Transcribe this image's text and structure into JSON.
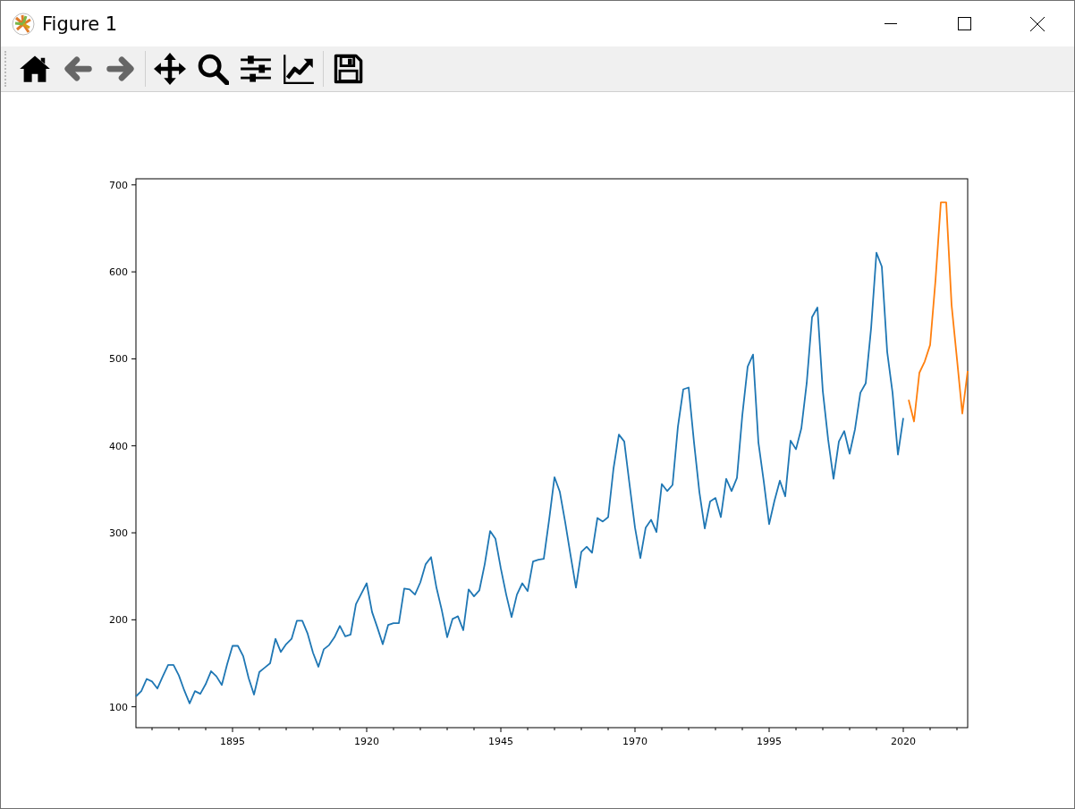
{
  "window": {
    "title": "Figure 1"
  },
  "toolbar": [
    [
      {
        "kind": "home",
        "disabled": false
      },
      {
        "kind": "back",
        "disabled": true
      },
      {
        "kind": "forward",
        "disabled": true
      }
    ],
    [
      {
        "kind": "pan",
        "disabled": false
      },
      {
        "kind": "zoom",
        "disabled": false
      },
      {
        "kind": "configure",
        "disabled": false
      },
      {
        "kind": "edit",
        "disabled": false
      }
    ],
    [
      {
        "kind": "save",
        "disabled": false
      }
    ]
  ],
  "figure": {
    "chart_data": {
      "type": "line",
      "x": [
        1877,
        1878,
        1879,
        1880,
        1881,
        1882,
        1883,
        1884,
        1885,
        1886,
        1887,
        1888,
        1889,
        1890,
        1891,
        1892,
        1893,
        1894,
        1895,
        1896,
        1897,
        1898,
        1899,
        1900,
        1901,
        1902,
        1903,
        1904,
        1905,
        1906,
        1907,
        1908,
        1909,
        1910,
        1911,
        1912,
        1913,
        1914,
        1915,
        1916,
        1917,
        1918,
        1919,
        1920,
        1921,
        1922,
        1923,
        1924,
        1925,
        1926,
        1927,
        1928,
        1929,
        1930,
        1931,
        1932,
        1933,
        1934,
        1935,
        1936,
        1937,
        1938,
        1939,
        1940,
        1941,
        1942,
        1943,
        1944,
        1945,
        1946,
        1947,
        1948,
        1949,
        1950,
        1951,
        1952,
        1953,
        1954,
        1955,
        1956,
        1957,
        1958,
        1959,
        1960,
        1961,
        1962,
        1963,
        1964,
        1965,
        1966,
        1967,
        1968,
        1969,
        1970,
        1971,
        1972,
        1973,
        1974,
        1975,
        1976,
        1977,
        1978,
        1979,
        1980,
        1981,
        1982,
        1983,
        1984,
        1985,
        1986,
        1987,
        1988,
        1989,
        1990,
        1991,
        1992,
        1993,
        1994,
        1995,
        1996,
        1997,
        1998,
        1999,
        2000,
        2001,
        2002,
        2003,
        2004,
        2005,
        2006,
        2007,
        2008,
        2009,
        2010,
        2011,
        2012,
        2013,
        2014,
        2015,
        2016,
        2017,
        2018,
        2019,
        2020,
        2021,
        2022,
        2023,
        2024,
        2025,
        2026,
        2027,
        2028,
        2029,
        2030,
        2031,
        2032
      ],
      "series": [
        {
          "color": "#1f77b4",
          "values": [
            112,
            118,
            132,
            129,
            121,
            135,
            148,
            148,
            136,
            119,
            104,
            118,
            115,
            126,
            141,
            135,
            125,
            149,
            170,
            170,
            158,
            133,
            114,
            140,
            145,
            150,
            178,
            163,
            172,
            178,
            199,
            199,
            184,
            162,
            146,
            166,
            171,
            180,
            193,
            181,
            183,
            218,
            230,
            242,
            209,
            191,
            172,
            194,
            196,
            196,
            236,
            235,
            229,
            243,
            264,
            272,
            237,
            211,
            180,
            201,
            204,
            188,
            235,
            227,
            234,
            264,
            302,
            293,
            259,
            229,
            203,
            229,
            242,
            233,
            267,
            269,
            270,
            315,
            364,
            347,
            312,
            274,
            237,
            278,
            284,
            277,
            317,
            313,
            318,
            374,
            413,
            405,
            355,
            306,
            271,
            306,
            315,
            301,
            356,
            348,
            355,
            422,
            465,
            467,
            404,
            347,
            305,
            336,
            340,
            318,
            362,
            348,
            363,
            435,
            491,
            505,
            404,
            359,
            310,
            337,
            360,
            342,
            406,
            396,
            420,
            472,
            548,
            559,
            463,
            407,
            362,
            405,
            417,
            391,
            419,
            461,
            472,
            535,
            622,
            606,
            508,
            461,
            390,
            432,
            null,
            null,
            null,
            null,
            null,
            null,
            null,
            null,
            null,
            null,
            null,
            null
          ]
        },
        {
          "color": "#ff7f0e",
          "values": [
            null,
            null,
            null,
            null,
            null,
            null,
            null,
            null,
            null,
            null,
            null,
            null,
            null,
            null,
            null,
            null,
            null,
            null,
            null,
            null,
            null,
            null,
            null,
            null,
            null,
            null,
            null,
            null,
            null,
            null,
            null,
            null,
            null,
            null,
            null,
            null,
            null,
            null,
            null,
            null,
            null,
            null,
            null,
            null,
            null,
            null,
            null,
            null,
            null,
            null,
            null,
            null,
            null,
            null,
            null,
            null,
            null,
            null,
            null,
            null,
            null,
            null,
            null,
            null,
            null,
            null,
            null,
            null,
            null,
            null,
            null,
            null,
            null,
            null,
            null,
            null,
            null,
            null,
            null,
            null,
            null,
            null,
            null,
            null,
            null,
            null,
            null,
            null,
            null,
            null,
            null,
            null,
            null,
            null,
            null,
            null,
            null,
            null,
            null,
            null,
            null,
            null,
            null,
            null,
            null,
            null,
            null,
            null,
            null,
            null,
            null,
            null,
            null,
            null,
            null,
            null,
            null,
            null,
            null,
            null,
            null,
            null,
            null,
            null,
            null,
            null,
            null,
            null,
            null,
            null,
            null,
            null,
            null,
            null,
            null,
            null,
            null,
            null,
            null,
            null,
            null,
            null,
            null,
            null,
            453,
            428,
            484,
            497,
            516,
            590,
            680,
            680,
            562,
            500,
            437,
            486
          ]
        }
      ],
      "xlim": [
        1877,
        2032
      ],
      "ylim": [
        76,
        707
      ],
      "xticks": [
        1895,
        1920,
        1945,
        1970,
        1995,
        2020
      ],
      "yticks": [
        100,
        200,
        300,
        400,
        500,
        600,
        700
      ]
    }
  }
}
